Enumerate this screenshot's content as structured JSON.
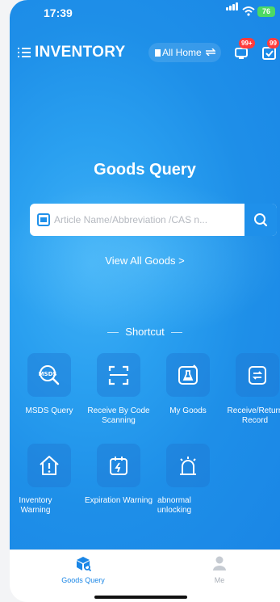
{
  "status_bar": {
    "time": "17:39",
    "battery": "76"
  },
  "header": {
    "title": "INVENTORY",
    "home_selector": "All Home",
    "notification_badge": "99+",
    "task_badge": "99"
  },
  "main": {
    "heading": "Goods Query",
    "search": {
      "placeholder": "Article Name/Abbreviation /CAS n..."
    },
    "view_all": "View All Goods >",
    "shortcut_title": "Shortcut",
    "shortcuts": [
      {
        "label": "MSDS Query",
        "icon": "msds-search-icon",
        "icon_text": "MSDS"
      },
      {
        "label": "Receive By Code Scanning",
        "icon": "scan-code-icon"
      },
      {
        "label": "My Goods",
        "icon": "flask-icon"
      },
      {
        "label": "Receive/Return Record",
        "icon": "record-icon"
      },
      {
        "label": "Inventory Warning",
        "icon": "house-warning-icon"
      },
      {
        "label": "Expiration Warning",
        "icon": "calendar-warning-icon"
      },
      {
        "label": "abnormal unlocking",
        "icon": "alarm-icon"
      }
    ]
  },
  "tabbar": {
    "items": [
      {
        "label": "Goods Query",
        "icon": "goods-query-icon",
        "active": true
      },
      {
        "label": "Me",
        "icon": "person-icon",
        "active": false
      }
    ]
  },
  "colors": {
    "accent": "#1f90ea",
    "active_tab": "#1a86e6",
    "inactive_tab": "#b9bec6",
    "badge": "#ff3b3b"
  }
}
